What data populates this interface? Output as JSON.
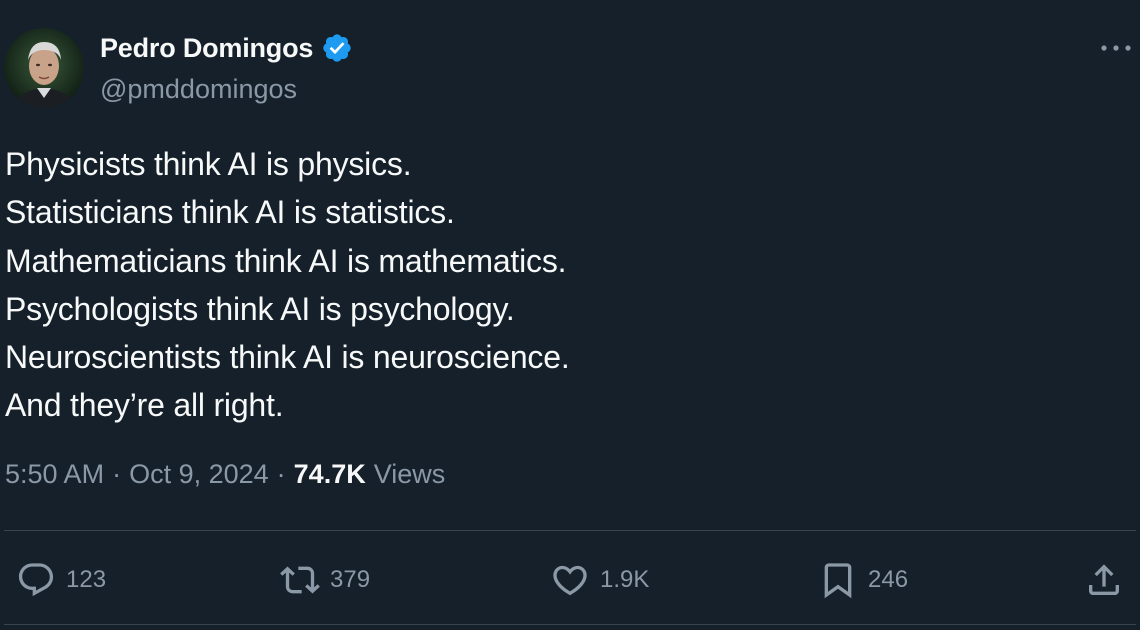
{
  "author": {
    "display_name": "Pedro Domingos",
    "handle": "@pmddomingos",
    "verified": true
  },
  "tweet": {
    "lines": [
      "Physicists think AI is physics.",
      "Statisticians think AI is statistics.",
      "Mathematicians think AI is mathematics.",
      "Psychologists think AI is psychology.",
      "Neuroscientists think AI is neuroscience.",
      "And they’re all right."
    ]
  },
  "meta": {
    "time": "5:50 AM",
    "separator": "·",
    "date": "Oct 9, 2024",
    "views_count": "74.7K",
    "views_label": "Views"
  },
  "actions": {
    "replies": "123",
    "reposts": "379",
    "likes": "1.9K",
    "bookmarks": "246"
  },
  "icons": {
    "more": "more-horizontal-icon",
    "verified": "verified-badge-icon",
    "reply": "reply-icon",
    "repost": "repost-icon",
    "like": "heart-icon",
    "bookmark": "bookmark-icon",
    "share": "share-icon"
  },
  "colors": {
    "background": "#15202b",
    "text_primary": "#f7f9f9",
    "text_secondary": "#8b98a5",
    "verified_blue": "#1d9bf0",
    "divider": "#38444d"
  }
}
